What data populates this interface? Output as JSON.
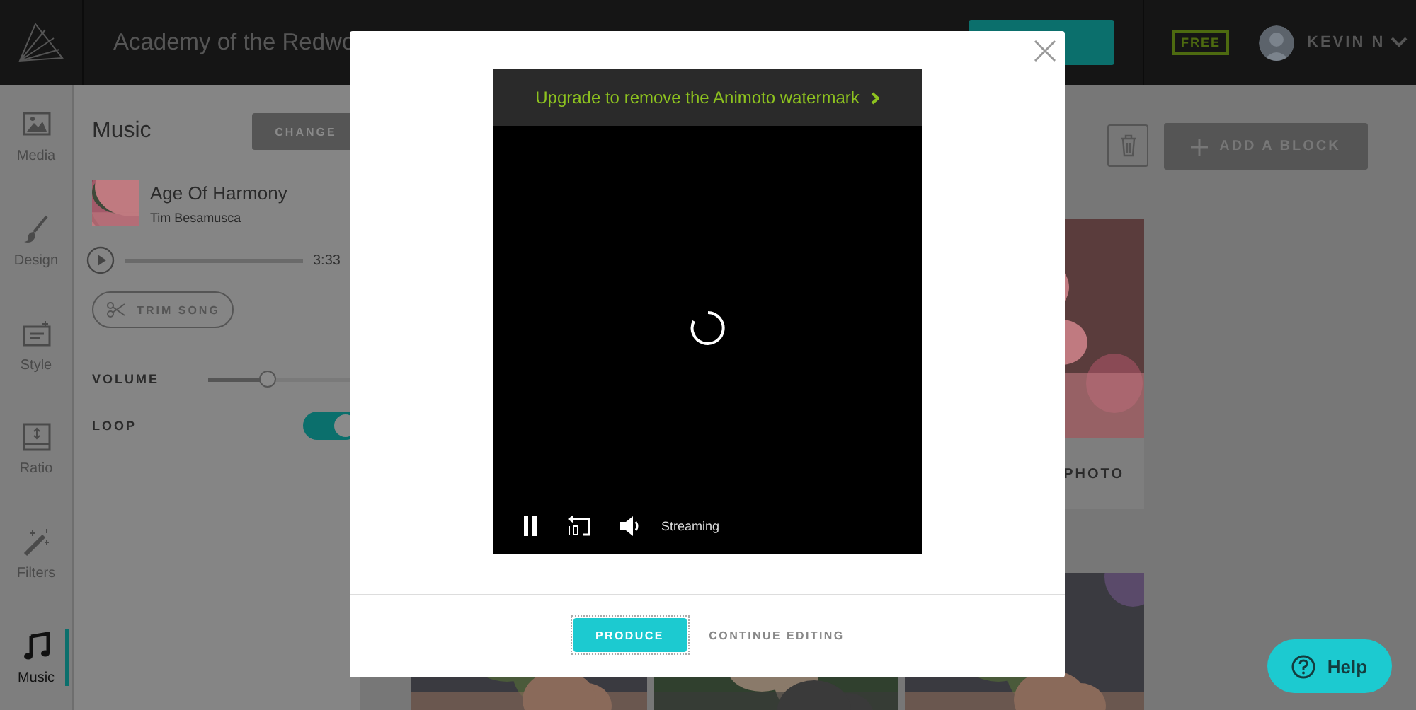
{
  "app_bar": {
    "title": "Academy of the Redwo",
    "plan_badge": "FREE",
    "user_name": "KEVIN N"
  },
  "sidebar": {
    "items": [
      {
        "kind": "media",
        "label": "Media",
        "selected": false
      },
      {
        "kind": "design",
        "label": "Design",
        "selected": false
      },
      {
        "kind": "style",
        "label": "Style",
        "selected": false
      },
      {
        "kind": "ratio",
        "label": "Ratio",
        "selected": false
      },
      {
        "kind": "filters",
        "label": "Filters",
        "selected": false
      },
      {
        "kind": "music",
        "label": "Music",
        "selected": true
      }
    ]
  },
  "music_panel": {
    "title": "Music",
    "change_button": "CHANGE",
    "track": {
      "title": "Age Of Harmony",
      "artist": "Tim Besamusca",
      "duration": "3:33",
      "progress": {
        "level": 0
      }
    },
    "trim_button": "TRIM SONG",
    "volume": {
      "label": "VOLUME",
      "level": 0.39
    },
    "loop": {
      "label": "LOOP",
      "on": true
    }
  },
  "toolbar": {
    "add_block_button": "ADD A BLOCK"
  },
  "photo_card": {
    "label": "PHOTO"
  },
  "modal": {
    "banner": "Upgrade to remove the Animoto watermark",
    "status": "Streaming",
    "produce_button": "PRODUCE",
    "continue_button": "CONTINUE EDITING"
  },
  "help_button": "Help"
}
